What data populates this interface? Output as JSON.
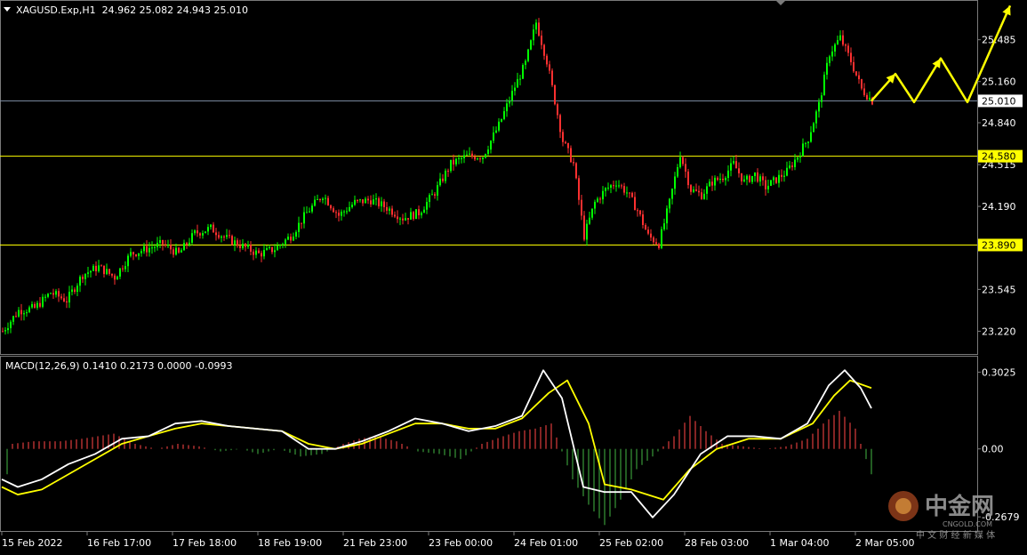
{
  "symbol_header": "XAGUSD.Exp,H1  24.962 25.082 24.943 25.010",
  "macd_header": "MACD(12,26,9) 0.1410 0.2173 0.0000 -0.0993",
  "colors": {
    "background": "#000000",
    "grid_line": "#2a2a2a",
    "bull_candle": "#00ff00",
    "bear_candle": "#ff3030",
    "support_line": "#ffff00",
    "current_price_line": "#7f8fa6",
    "macd_line": "#ffffff",
    "signal_line": "#ffff00",
    "hist_positive": "#b03030",
    "hist_negative": "#2d7a2d",
    "forecast_arrow": "#ffff00",
    "axis_text": "#ffffff"
  },
  "watermark": {
    "logo_text": "中金网",
    "logo_subtext": "CNGOLD.COM",
    "tagline": "中 文 财 经 新 媒 体"
  },
  "chart_data": [
    {
      "type": "candlestick",
      "symbol": "XAGUSD.Exp",
      "timeframe": "H1",
      "ohlc_last": {
        "open": 24.962,
        "high": 25.082,
        "low": 24.943,
        "close": 25.01
      },
      "ylim": [
        23.05,
        25.78
      ],
      "y_ticks": [
        "25.485",
        "25.160",
        "24.840",
        "24.515",
        "24.190",
        "23.545",
        "23.220"
      ],
      "current_price": "25.010",
      "support_levels": [
        "24.580",
        "23.890"
      ],
      "x_ticks": [
        "15 Feb 2022",
        "16 Feb 17:00",
        "17 Feb 18:00",
        "18 Feb 19:00",
        "21 Feb 23:00",
        "23 Feb 00:00",
        "24 Feb 01:00",
        "25 Feb 02:00",
        "28 Feb 03:00",
        "1 Mar 04:00",
        "2 Mar 05:00"
      ],
      "close_path": [
        [
          0,
          23.22
        ],
        [
          6,
          23.38
        ],
        [
          12,
          23.4
        ],
        [
          18,
          23.52
        ],
        [
          24,
          23.46
        ],
        [
          30,
          23.66
        ],
        [
          36,
          23.72
        ],
        [
          42,
          23.64
        ],
        [
          48,
          23.82
        ],
        [
          54,
          23.86
        ],
        [
          60,
          23.9
        ],
        [
          66,
          23.82
        ],
        [
          72,
          23.98
        ],
        [
          78,
          24.02
        ],
        [
          84,
          23.94
        ],
        [
          90,
          23.88
        ],
        [
          96,
          23.82
        ],
        [
          102,
          23.86
        ],
        [
          108,
          23.96
        ],
        [
          114,
          24.14
        ],
        [
          120,
          24.28
        ],
        [
          126,
          24.12
        ],
        [
          132,
          24.22
        ],
        [
          138,
          24.24
        ],
        [
          144,
          24.18
        ],
        [
          150,
          24.1
        ],
        [
          156,
          24.14
        ],
        [
          162,
          24.3
        ],
        [
          168,
          24.52
        ],
        [
          174,
          24.58
        ],
        [
          180,
          24.58
        ],
        [
          186,
          24.82
        ],
        [
          192,
          25.12
        ],
        [
          196,
          25.3
        ],
        [
          200,
          25.62
        ],
        [
          204,
          25.32
        ],
        [
          210,
          24.7
        ],
        [
          214,
          24.52
        ],
        [
          218,
          23.96
        ],
        [
          222,
          24.22
        ],
        [
          226,
          24.32
        ],
        [
          230,
          24.38
        ],
        [
          234,
          24.3
        ],
        [
          238,
          24.16
        ],
        [
          242,
          23.96
        ],
        [
          246,
          23.9
        ],
        [
          250,
          24.22
        ],
        [
          254,
          24.6
        ],
        [
          258,
          24.32
        ],
        [
          262,
          24.28
        ],
        [
          266,
          24.38
        ],
        [
          270,
          24.42
        ],
        [
          274,
          24.52
        ],
        [
          278,
          24.38
        ],
        [
          282,
          24.44
        ],
        [
          286,
          24.34
        ],
        [
          290,
          24.4
        ],
        [
          294,
          24.46
        ],
        [
          298,
          24.58
        ],
        [
          302,
          24.72
        ],
        [
          306,
          24.98
        ],
        [
          310,
          25.38
        ],
        [
          314,
          25.5
        ],
        [
          318,
          25.32
        ],
        [
          322,
          25.1
        ],
        [
          326,
          25.01
        ]
      ],
      "forecast_path": [
        [
          326,
          25.01
        ],
        [
          335,
          25.22
        ],
        [
          342,
          25.0
        ],
        [
          352,
          25.34
        ],
        [
          362,
          25.0
        ],
        [
          378,
          25.75
        ]
      ]
    },
    {
      "type": "macd",
      "params": "12,26,9",
      "values": {
        "main": 0.141,
        "signal": 0.2173,
        "level": 0.0,
        "histogram": -0.0993
      },
      "ylim": [
        -0.32,
        0.36
      ],
      "y_ticks": [
        "0.3025",
        "0.00",
        "-0.2679"
      ],
      "macd_line": [
        [
          0,
          -0.12
        ],
        [
          6,
          -0.15
        ],
        [
          15,
          -0.12
        ],
        [
          25,
          -0.06
        ],
        [
          35,
          -0.02
        ],
        [
          45,
          0.04
        ],
        [
          55,
          0.05
        ],
        [
          65,
          0.1
        ],
        [
          75,
          0.11
        ],
        [
          85,
          0.09
        ],
        [
          95,
          0.08
        ],
        [
          105,
          0.07
        ],
        [
          115,
          0.0
        ],
        [
          125,
          0.0
        ],
        [
          135,
          0.03
        ],
        [
          145,
          0.07
        ],
        [
          155,
          0.12
        ],
        [
          165,
          0.1
        ],
        [
          175,
          0.07
        ],
        [
          185,
          0.09
        ],
        [
          195,
          0.13
        ],
        [
          203,
          0.31
        ],
        [
          210,
          0.2
        ],
        [
          218,
          -0.15
        ],
        [
          226,
          -0.17
        ],
        [
          236,
          -0.17
        ],
        [
          244,
          -0.27
        ],
        [
          252,
          -0.18
        ],
        [
          262,
          -0.02
        ],
        [
          272,
          0.05
        ],
        [
          282,
          0.05
        ],
        [
          292,
          0.04
        ],
        [
          302,
          0.1
        ],
        [
          310,
          0.25
        ],
        [
          316,
          0.31
        ],
        [
          322,
          0.24
        ],
        [
          326,
          0.16
        ]
      ],
      "signal_line": [
        [
          0,
          -0.15
        ],
        [
          6,
          -0.18
        ],
        [
          15,
          -0.16
        ],
        [
          25,
          -0.1
        ],
        [
          35,
          -0.04
        ],
        [
          45,
          0.02
        ],
        [
          55,
          0.05
        ],
        [
          65,
          0.08
        ],
        [
          75,
          0.1
        ],
        [
          85,
          0.09
        ],
        [
          95,
          0.08
        ],
        [
          105,
          0.07
        ],
        [
          115,
          0.02
        ],
        [
          125,
          0.0
        ],
        [
          135,
          0.02
        ],
        [
          145,
          0.06
        ],
        [
          155,
          0.1
        ],
        [
          165,
          0.1
        ],
        [
          175,
          0.08
        ],
        [
          185,
          0.08
        ],
        [
          195,
          0.12
        ],
        [
          205,
          0.22
        ],
        [
          212,
          0.27
        ],
        [
          220,
          0.1
        ],
        [
          226,
          -0.14
        ],
        [
          236,
          -0.16
        ],
        [
          248,
          -0.2
        ],
        [
          258,
          -0.08
        ],
        [
          268,
          0.0
        ],
        [
          280,
          0.04
        ],
        [
          292,
          0.04
        ],
        [
          304,
          0.1
        ],
        [
          312,
          0.21
        ],
        [
          318,
          0.27
        ],
        [
          326,
          0.24
        ]
      ],
      "histogram": [
        [
          4,
          0.02
        ],
        [
          12,
          0.03
        ],
        [
          22,
          0.03
        ],
        [
          30,
          0.04
        ],
        [
          36,
          0.05
        ],
        [
          42,
          0.06
        ],
        [
          50,
          0.02
        ],
        [
          58,
          0.0
        ],
        [
          66,
          0.02
        ],
        [
          74,
          0.01
        ],
        [
          82,
          -0.01
        ],
        [
          90,
          0.0
        ],
        [
          96,
          -0.02
        ],
        [
          104,
          0.0
        ],
        [
          112,
          -0.03
        ],
        [
          120,
          -0.02
        ],
        [
          128,
          0.02
        ],
        [
          134,
          0.04
        ],
        [
          140,
          0.05
        ],
        [
          148,
          0.03
        ],
        [
          156,
          -0.01
        ],
        [
          164,
          -0.02
        ],
        [
          172,
          -0.04
        ],
        [
          180,
          0.02
        ],
        [
          188,
          0.05
        ],
        [
          194,
          0.07
        ],
        [
          200,
          0.08
        ],
        [
          206,
          0.1
        ],
        [
          214,
          -0.12
        ],
        [
          220,
          -0.22
        ],
        [
          226,
          -0.3
        ],
        [
          232,
          -0.2
        ],
        [
          238,
          -0.08
        ],
        [
          244,
          -0.03
        ],
        [
          252,
          0.05
        ],
        [
          258,
          0.13
        ],
        [
          264,
          0.07
        ],
        [
          270,
          0.02
        ],
        [
          278,
          0.01
        ],
        [
          286,
          0.0
        ],
        [
          294,
          0.01
        ],
        [
          302,
          0.04
        ],
        [
          308,
          0.1
        ],
        [
          314,
          0.15
        ],
        [
          320,
          0.08
        ],
        [
          326,
          -0.1
        ]
      ]
    }
  ]
}
